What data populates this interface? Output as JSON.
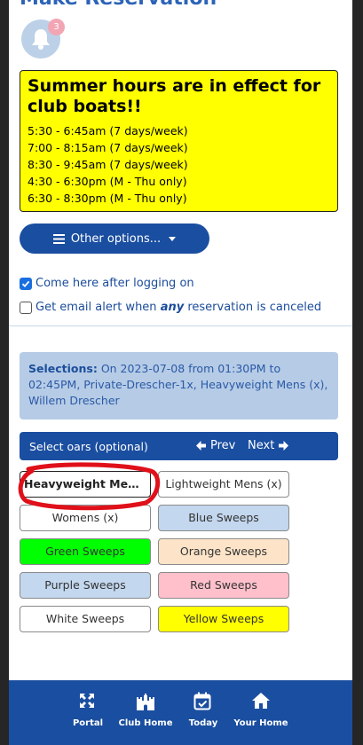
{
  "page_title": "Make Reservation",
  "notifications": {
    "count": "3"
  },
  "notice": {
    "title": "Summer hours are in effect for club boats!!",
    "lines": [
      "5:30 - 6:45am (7 days/week)",
      "7:00 - 8:15am (7 days/week)",
      "8:30 - 9:45am (7 days/week)",
      "4:30 - 6:30pm (M - Thu only)",
      "6:30 - 8:30pm (M - Thu only)"
    ]
  },
  "other_options_label": "Other options...",
  "checkboxes": {
    "come_here": {
      "label": "Come here after logging on",
      "checked": true
    },
    "email_alert": {
      "prefix": "Get email alert when ",
      "emph": "any",
      "suffix": " reservation is canceled",
      "checked": false
    }
  },
  "selections": {
    "label": "Selections:",
    "text": " On 2023-07-08 from 01:30PM to 02:45PM, Private-Drescher-1x, Heavyweight Mens (x), Willem Drescher"
  },
  "oars_bar": {
    "label": "Select oars (optional)",
    "prev": "Prev",
    "next": "Next"
  },
  "oars": [
    {
      "label": "Heavyweight Mens ...",
      "bg": "#ffffff",
      "selected": true
    },
    {
      "label": "Lightweight Mens (x)",
      "bg": "#ffffff"
    },
    {
      "label": "Womens (x)",
      "bg": "#ffffff"
    },
    {
      "label": "Blue Sweeps",
      "bg": "#c3d7ee"
    },
    {
      "label": "Green Sweeps",
      "bg": "#00ff00"
    },
    {
      "label": "Orange Sweeps",
      "bg": "#fde4c8"
    },
    {
      "label": "Purple Sweeps",
      "bg": "#c3d7ee"
    },
    {
      "label": "Red Sweeps",
      "bg": "#ffc0cb"
    },
    {
      "label": "White Sweeps",
      "bg": "#ffffff"
    },
    {
      "label": "Yellow Sweeps",
      "bg": "#ffff00"
    }
  ],
  "nav": [
    {
      "label": "Portal",
      "icon": "expand-icon"
    },
    {
      "label": "Club Home",
      "icon": "castle-icon"
    },
    {
      "label": "Today",
      "icon": "calendar-check-icon"
    },
    {
      "label": "Your Home",
      "icon": "home-icon"
    }
  ]
}
